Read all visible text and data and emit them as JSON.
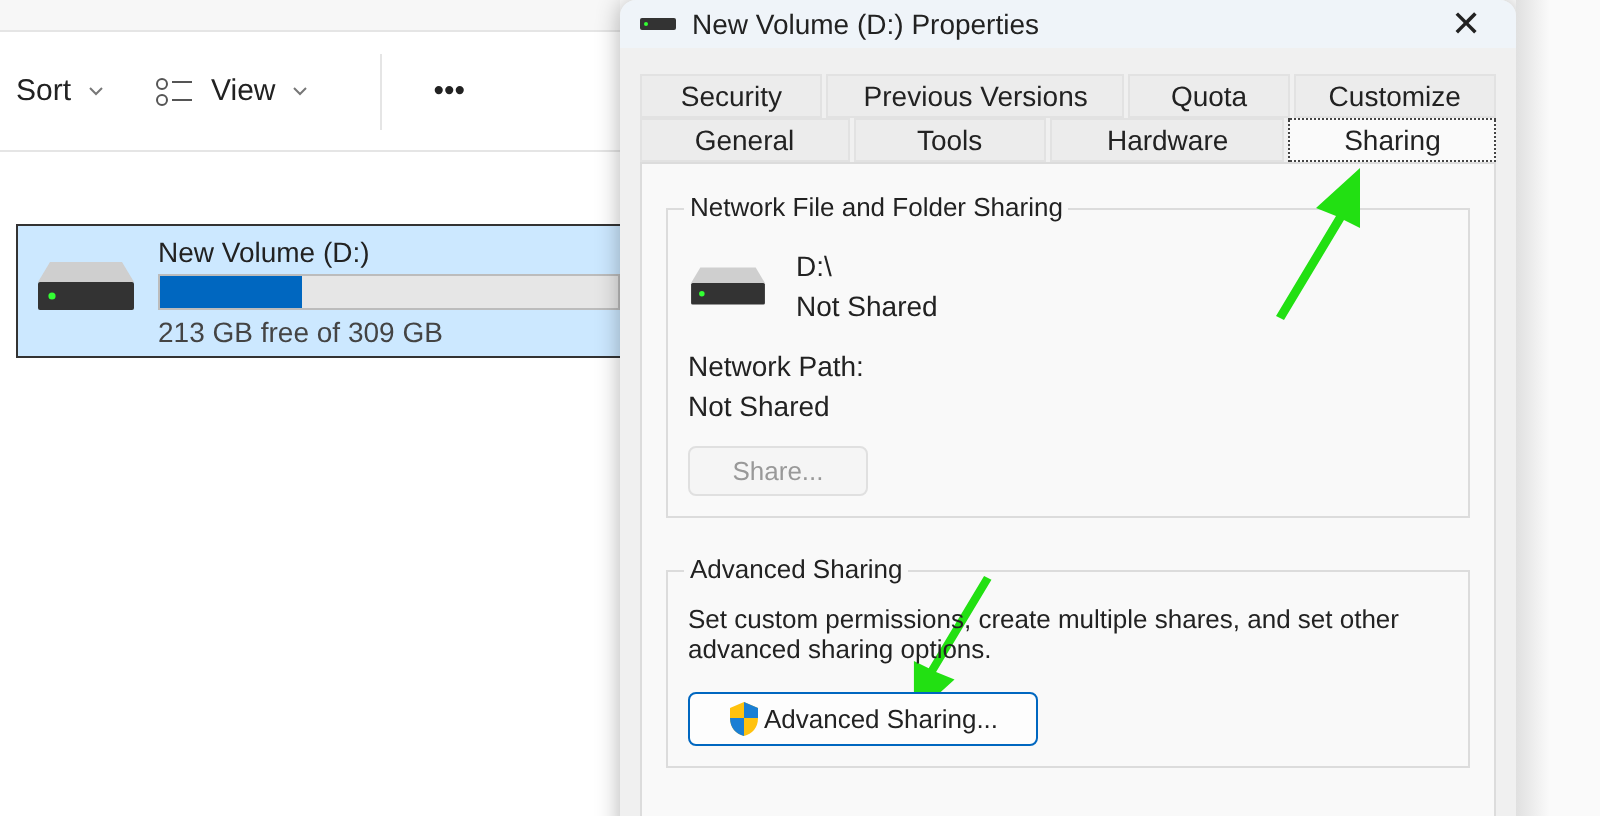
{
  "explorer": {
    "toolbar": [
      {
        "kind": "dropdown",
        "label": "Sort"
      },
      {
        "kind": "view",
        "label": "View"
      },
      {
        "kind": "more",
        "label": "•••"
      }
    ],
    "drive": {
      "name": "New Volume (D:)",
      "level": 0.31,
      "free": "213 GB free of 309 GB",
      "selected": true
    }
  },
  "dialog": {
    "title": "New Volume (D:) Properties",
    "close": "✕",
    "tab_rows": [
      [
        {
          "label": "Security",
          "selected": false
        },
        {
          "label": "Previous Versions",
          "selected": false
        },
        {
          "label": "Quota",
          "selected": false
        },
        {
          "label": "Customize",
          "selected": false
        }
      ],
      [
        {
          "label": "General",
          "selected": false
        },
        {
          "label": "Tools",
          "selected": false
        },
        {
          "label": "Hardware",
          "selected": false
        },
        {
          "label": "Sharing",
          "selected": true
        }
      ]
    ],
    "network_sharing": {
      "legend": "Network File and Folder Sharing",
      "path": "D:\\",
      "status": "Not Shared",
      "network_path_label": "Network Path:",
      "network_path": "Not Shared",
      "button": {
        "label": "Share...",
        "disabled": true
      }
    },
    "advanced_sharing": {
      "legend": "Advanced Sharing",
      "description": "Set custom permissions, create multiple shares, and set other advanced sharing options.",
      "button": {
        "label": "Advanced Sharing...",
        "disabled": false
      }
    }
  }
}
